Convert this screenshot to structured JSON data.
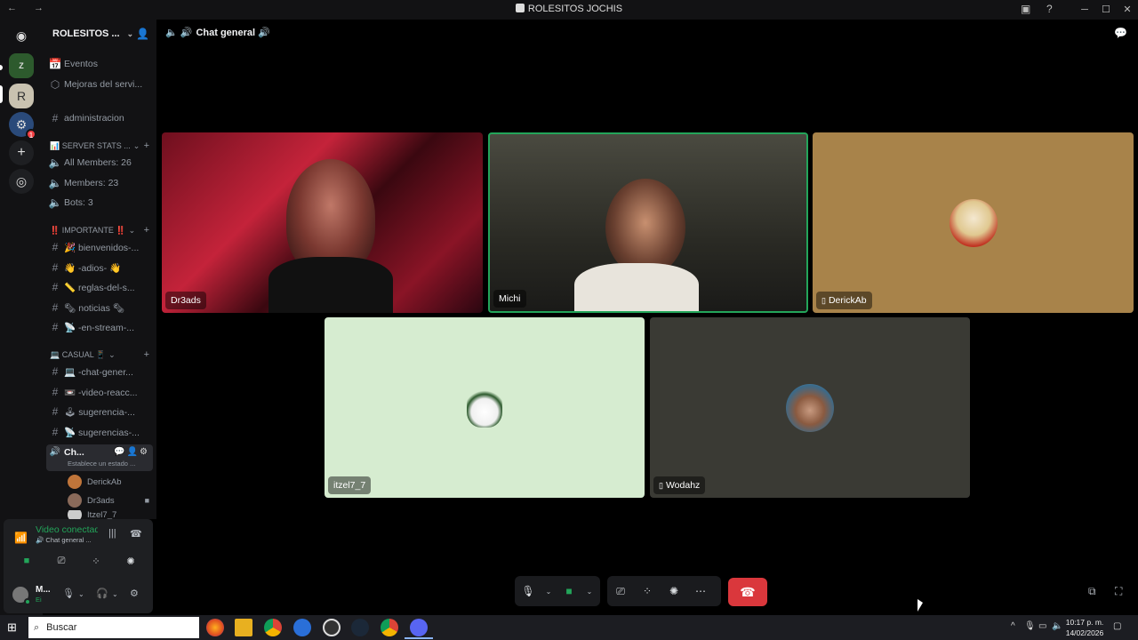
{
  "window": {
    "title": "ROLESITOS JOCHIS",
    "nav": "← →",
    "controls": [
      "─",
      "☐",
      "✕"
    ]
  },
  "server_rail": {
    "items": [
      {
        "name": "discord-home",
        "glyph": "◉"
      },
      {
        "name": "zomber-server",
        "glyph": "Z"
      },
      {
        "name": "rolesitos-server",
        "glyph": "R"
      },
      {
        "name": "server-3",
        "glyph": "⚙",
        "badge": "1"
      },
      {
        "name": "add-server",
        "glyph": "+"
      },
      {
        "name": "discover",
        "glyph": "◎"
      }
    ]
  },
  "sidebar": {
    "server_name": "ROLESITOS ...",
    "channels_top": [
      {
        "icon": "📅",
        "label": "Eventos"
      },
      {
        "icon": "⬡",
        "label": "Mejoras del servi..."
      }
    ],
    "admin_channel": "administracion",
    "category_stats": "📊 SERVER STATS ...",
    "stats": [
      "All Members: 26",
      "Members: 23",
      "Bots: 3"
    ],
    "category_importante": "‼️ IMPORTANTE ‼️",
    "importante_channels": [
      "🎉 bienvenidos-...",
      "👋 -adios- 👋",
      "📏 reglas-del-s...",
      "🗞 noticias 🗞",
      "📡 -en-stream-..."
    ],
    "category_casual": "💻 CASUAL 📱",
    "casual_channels": [
      "💻 -chat-gener...",
      "📼 -video-reacc...",
      "🕹 sugerencia-...",
      "📡 sugerencias-..."
    ],
    "active_voice": {
      "label": "Ch...",
      "status": "Establece un estado ..."
    },
    "voice_users": [
      "DerickAb",
      "Dr3ads",
      "Itzel7_7"
    ]
  },
  "voice_panel": {
    "status": "Video conectado",
    "channel": "🔊 Chat general ...",
    "user_name": "M...",
    "user_status": "Ei"
  },
  "main": {
    "channel_title": "Chat general",
    "tiles": [
      {
        "name": "Dr3ads",
        "mobile": false
      },
      {
        "name": "Michi",
        "mobile": false
      },
      {
        "name": "DerickAb",
        "mobile": true
      },
      {
        "name": "itzel7_7",
        "mobile": false
      },
      {
        "name": "Wodahz",
        "mobile": true
      }
    ]
  },
  "taskbar": {
    "search_placeholder": "Buscar",
    "time": "10:17 p. m.",
    "date": "14/02/2026"
  },
  "colors": {
    "accent_green": "#23a55a",
    "hangup_red": "#da373c",
    "tile_derick": "#a8834a",
    "tile_itzel": "#d6ecd0",
    "tile_wodahz": "#3a3a34"
  }
}
